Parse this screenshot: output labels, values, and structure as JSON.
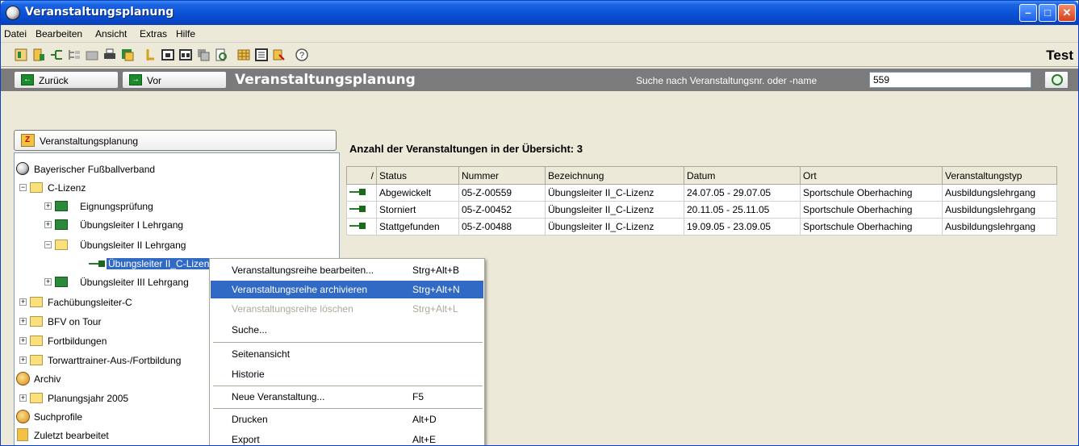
{
  "window": {
    "title": "Veranstaltungsplanung"
  },
  "menu": [
    "Datei",
    "Bearbeiten",
    "Ansicht",
    "Extras",
    "Hilfe"
  ],
  "toolbar": {
    "brand": "Test"
  },
  "nav": {
    "back_label": "Zurück",
    "forward_label": "Vor",
    "title": "Veranstaltungsplanung",
    "search_label": "Suche nach Veranstaltungsnr. oder -name",
    "search_value": "559"
  },
  "tree": {
    "header": "Veranstaltungsplanung",
    "items": [
      "Bayerischer Fußballverband",
      "C-Lizenz",
      "Eignungsprüfung",
      "Übungsleiter I Lehrgang",
      "Übungsleiter II Lehrgang",
      "Übungsleiter II_C-Lizenz",
      "Übungsleiter III Lehrgang",
      "Fachübungsleiter-C",
      "BFV on Tour",
      "Fortbildungen",
      "Torwarttrainer-Aus-/Fortbildung",
      "Archiv",
      "Planungsjahr 2005",
      "Suchprofile",
      "Zuletzt bearbeitet"
    ]
  },
  "overview": {
    "count_label": "Anzahl der Veranstaltungen in der Übersicht: 3",
    "columns": [
      "/",
      "Status",
      "Nummer",
      "Bezeichnung",
      "Datum",
      "Ort",
      "Veranstaltungstyp"
    ],
    "rows": [
      [
        "Abgewickelt",
        "05-Z-00559",
        "Übungsleiter II_C-Lizenz",
        "24.07.05 - 29.07.05",
        "Sportschule Oberhaching",
        "Ausbildungslehrgang"
      ],
      [
        "Storniert",
        "05-Z-00452",
        "Übungsleiter II_C-Lizenz",
        "20.11.05 - 25.11.05",
        "Sportschule Oberhaching",
        "Ausbildungslehrgang"
      ],
      [
        "Stattgefunden",
        "05-Z-00488",
        "Übungsleiter II_C-Lizenz",
        "19.09.05 - 23.09.05",
        "Sportschule Oberhaching",
        "Ausbildungslehrgang"
      ]
    ]
  },
  "context_menu": [
    {
      "label": "Veranstaltungsreihe bearbeiten...",
      "shortcut": "Strg+Alt+B"
    },
    {
      "label": "Veranstaltungsreihe archivieren",
      "shortcut": "Strg+Alt+N"
    },
    {
      "label": "Veranstaltungsreihe löschen",
      "shortcut": "Strg+Alt+L"
    },
    {
      "label": "Suche...",
      "shortcut": ""
    },
    {
      "label": "Seitenansicht",
      "shortcut": ""
    },
    {
      "label": "Historie",
      "shortcut": ""
    },
    {
      "label": "Neue Veranstaltung...",
      "shortcut": "F5"
    },
    {
      "label": "Drucken",
      "shortcut": "Alt+D"
    },
    {
      "label": "Export",
      "shortcut": "Alt+E"
    }
  ]
}
